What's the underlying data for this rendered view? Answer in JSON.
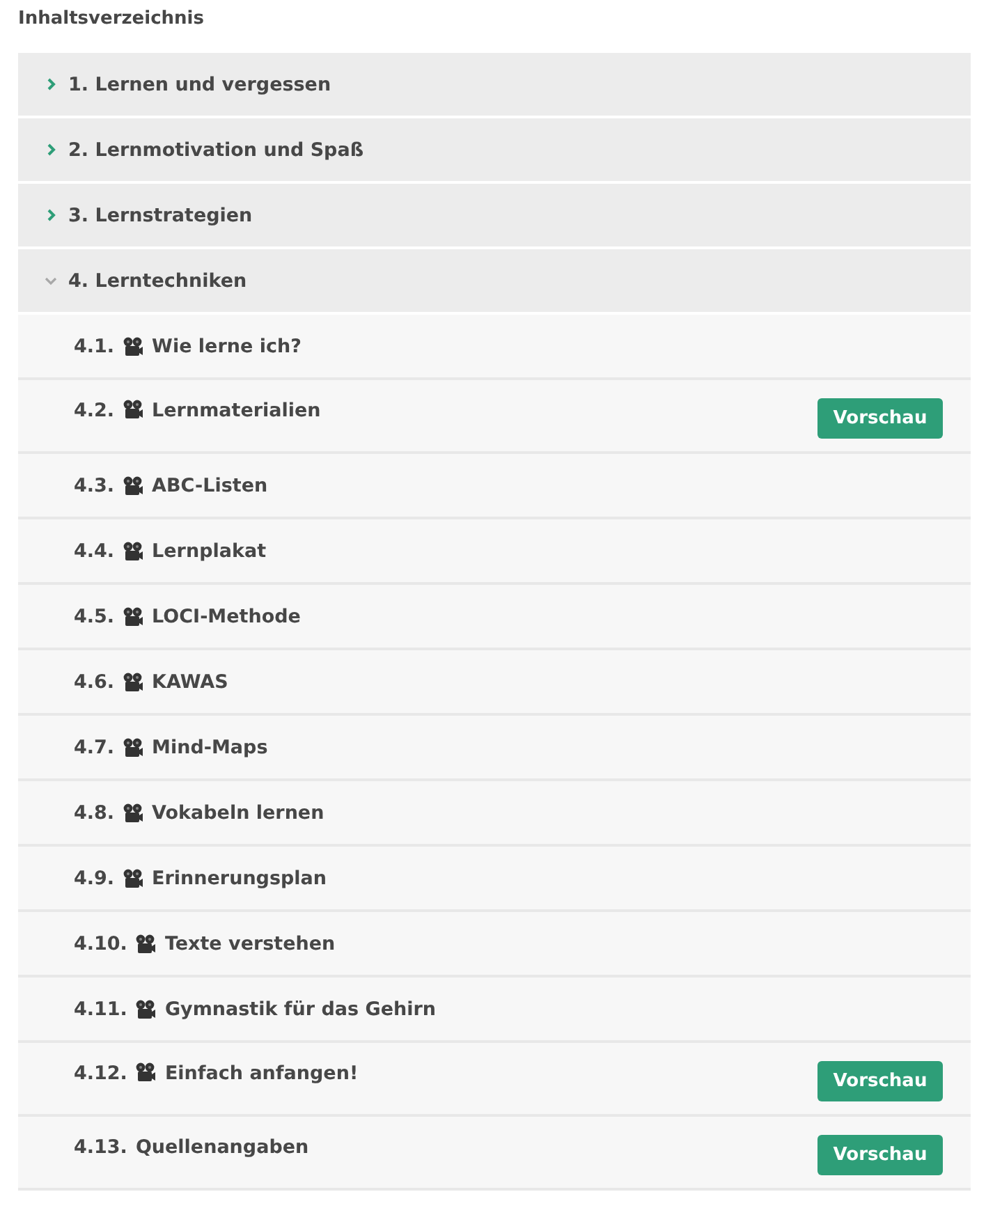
{
  "heading": "Inhaltsverzeichnis",
  "chapters": [
    {
      "title": "1. Lernen und vergessen",
      "expanded": false
    },
    {
      "title": "2. Lernmotivation und Spaß",
      "expanded": false
    },
    {
      "title": "3. Lernstrategien",
      "expanded": false
    },
    {
      "title": "4. Lerntechniken",
      "expanded": true,
      "lessons": [
        {
          "number": "4.1.",
          "kind": "video",
          "title": "Wie lerne ich?"
        },
        {
          "number": "4.2.",
          "kind": "video",
          "title": "Lernmaterialien",
          "preview": "Vorschau"
        },
        {
          "number": "4.3.",
          "kind": "video",
          "title": "ABC-Listen"
        },
        {
          "number": "4.4.",
          "kind": "video",
          "title": "Lernplakat"
        },
        {
          "number": "4.5.",
          "kind": "video",
          "title": "LOCI-Methode"
        },
        {
          "number": "4.6.",
          "kind": "video",
          "title": "KAWAS"
        },
        {
          "number": "4.7.",
          "kind": "video",
          "title": "Mind-Maps"
        },
        {
          "number": "4.8.",
          "kind": "video",
          "title": "Vokabeln lernen"
        },
        {
          "number": "4.9.",
          "kind": "video",
          "title": "Erinnerungsplan"
        },
        {
          "number": "4.10.",
          "kind": "video",
          "title": "Texte verstehen"
        },
        {
          "number": "4.11.",
          "kind": "video",
          "title": "Gymnastik für das Gehirn"
        },
        {
          "number": "4.12.",
          "kind": "video",
          "title": "Einfach anfangen!",
          "preview": "Vorschau"
        },
        {
          "number": "4.13.",
          "kind": "text",
          "title": "Quellenangaben",
          "preview": "Vorschau"
        }
      ]
    }
  ]
}
